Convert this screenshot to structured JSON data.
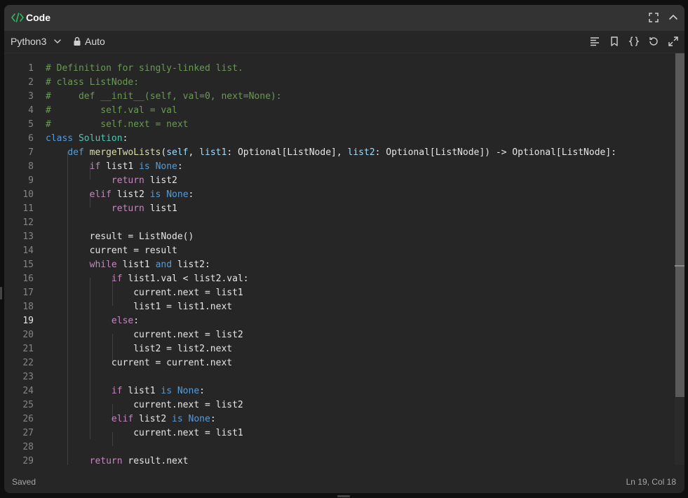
{
  "window": {
    "title": "Code",
    "title_icon": "code-icon",
    "accent_color": "#2cbb5d",
    "controls": [
      "fullscreen-icon",
      "collapse-chevron-icon"
    ]
  },
  "toolbar": {
    "language": "Python3",
    "mode": "Auto",
    "tools": [
      "format-icon",
      "bookmark-icon",
      "braces-icon",
      "reset-icon",
      "expand-icon"
    ]
  },
  "editor": {
    "active_line": 19,
    "lines": [
      {
        "n": "1",
        "text": "# Definition for singly-linked list."
      },
      {
        "n": "2",
        "text": "# class ListNode:"
      },
      {
        "n": "3",
        "text": "#     def __init__(self, val=0, next=None):"
      },
      {
        "n": "4",
        "text": "#         self.val = val"
      },
      {
        "n": "5",
        "text": "#         self.next = next"
      },
      {
        "n": "6",
        "text": "class Solution:"
      },
      {
        "n": "7",
        "text": "    def mergeTwoLists(self, list1: Optional[ListNode], list2: Optional[ListNode]) -> Optional[ListNode]:"
      },
      {
        "n": "8",
        "text": "        if list1 is None:"
      },
      {
        "n": "9",
        "text": "            return list2"
      },
      {
        "n": "10",
        "text": "        elif list2 is None:"
      },
      {
        "n": "11",
        "text": "            return list1"
      },
      {
        "n": "12",
        "text": ""
      },
      {
        "n": "13",
        "text": "        result = ListNode()"
      },
      {
        "n": "14",
        "text": "        current = result"
      },
      {
        "n": "15",
        "text": "        while list1 and list2:"
      },
      {
        "n": "16",
        "text": "            if list1.val < list2.val:"
      },
      {
        "n": "17",
        "text": "                current.next = list1"
      },
      {
        "n": "18",
        "text": "                list1 = list1.next"
      },
      {
        "n": "19",
        "text": "            else:"
      },
      {
        "n": "20",
        "text": "                current.next = list2"
      },
      {
        "n": "21",
        "text": "                list2 = list2.next"
      },
      {
        "n": "22",
        "text": "            current = current.next"
      },
      {
        "n": "23",
        "text": ""
      },
      {
        "n": "24",
        "text": "            if list1 is None:"
      },
      {
        "n": "25",
        "text": "                current.next = list2"
      },
      {
        "n": "26",
        "text": "            elif list2 is None:"
      },
      {
        "n": "27",
        "text": "                current.next = list1"
      },
      {
        "n": "28",
        "text": ""
      },
      {
        "n": "29",
        "text": "        return result.next"
      }
    ]
  },
  "status": {
    "saved": "Saved",
    "cursor": "Ln 19, Col 18"
  }
}
